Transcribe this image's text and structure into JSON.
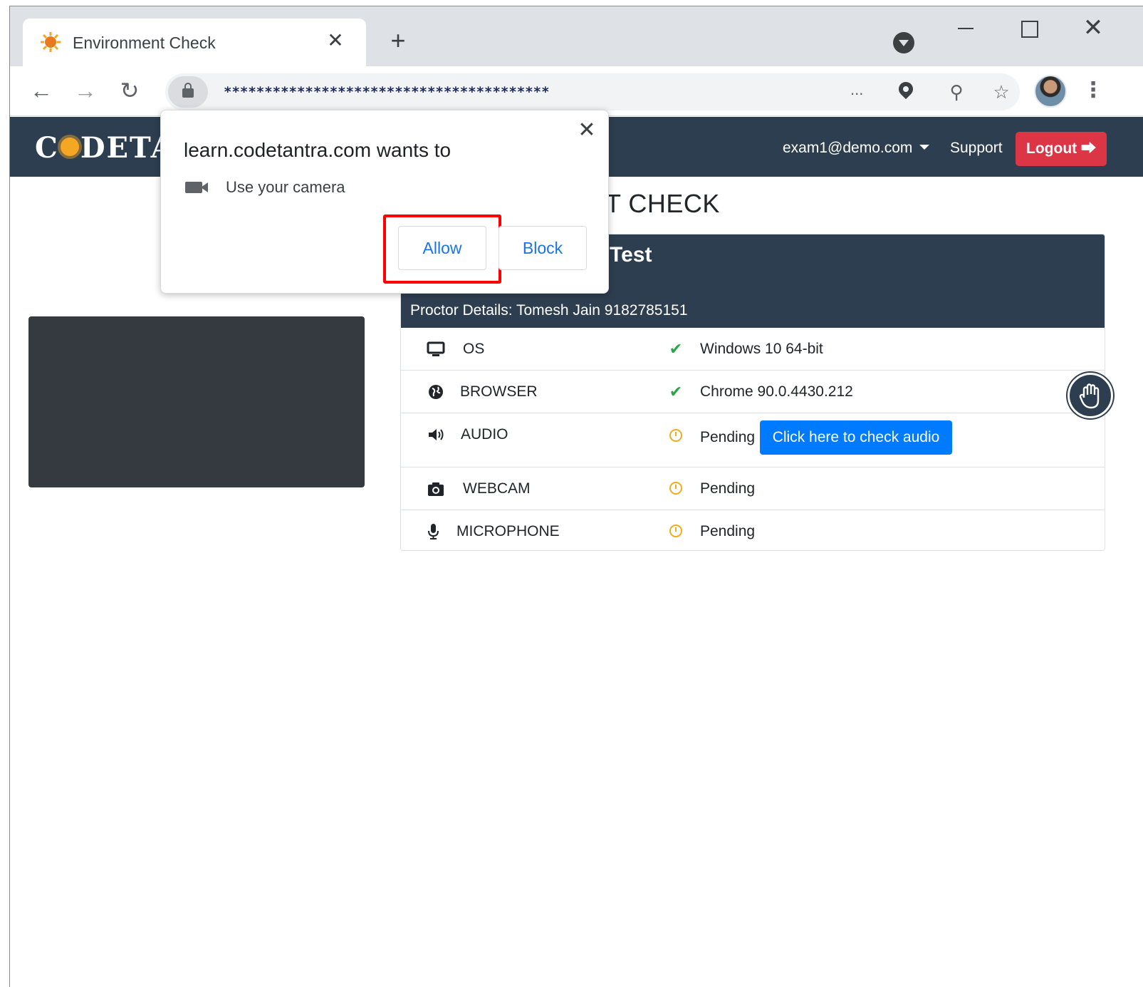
{
  "browser": {
    "tab_title": "Environment Check",
    "tab_close": "✕",
    "new_tab": "+",
    "url": "****************************************",
    "omnibox_ellipsis": "...",
    "back": "←",
    "forward": "→",
    "reload": "↻",
    "zoom": "⚲",
    "bookmark": "☆",
    "menu": "⋮",
    "close_window": "✕"
  },
  "navbar": {
    "brand_prefix": "C",
    "brand_suffix": "DETA",
    "user_email": "exam1@demo.com",
    "support": "Support",
    "logout": "Logout ⮕"
  },
  "page": {
    "heading": "T CHECK",
    "card_title": "Test",
    "proctor": "Proctor Details: Tomesh Jain 9182785151"
  },
  "checks": [
    {
      "name": "OS",
      "status_icon": "check-icon",
      "value": "Windows 10 64-bit"
    },
    {
      "name": "BROWSER",
      "status_icon": "check-icon",
      "value": "Chrome 90.0.4430.212"
    },
    {
      "name": "AUDIO",
      "status_icon": "clock-icon",
      "value": "Pending",
      "action": "Click here to check audio"
    },
    {
      "name": "WEBCAM",
      "status_icon": "clock-icon",
      "value": "Pending"
    },
    {
      "name": "MICROPHONE",
      "status_icon": "clock-icon",
      "value": "Pending"
    }
  ],
  "popup": {
    "title": "learn.codetantra.com wants to",
    "permission": "Use your camera",
    "allow": "Allow",
    "block": "Block",
    "close": "✕"
  },
  "colors": {
    "navbar": "#2d3e50",
    "logout": "#dc3545",
    "primary": "#007bff",
    "success": "#28a745",
    "pending": "#f0ad1e",
    "highlight": "#ff0000",
    "link_blue": "#1a73e8"
  }
}
